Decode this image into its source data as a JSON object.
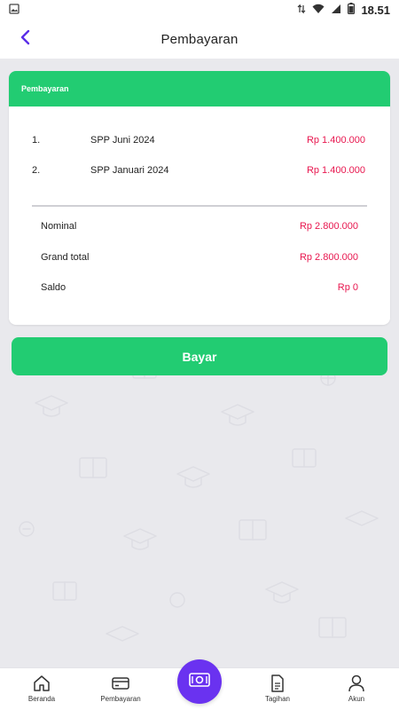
{
  "status_bar": {
    "time": "18.51",
    "icons": [
      "image-icon",
      "data-arrows-icon",
      "wifi-icon",
      "signal-icon",
      "battery-icon"
    ]
  },
  "header": {
    "title": "Pembayaran",
    "back_icon": "chevron-left-icon",
    "back_color": "#5b2ee8"
  },
  "card": {
    "header_title": "Pembayaran",
    "header_color": "#22cc72",
    "items": [
      {
        "number": "1.",
        "name": "SPP Juni 2024",
        "amount": "Rp 1.400.000"
      },
      {
        "number": "2.",
        "name": "SPP Januari 2024",
        "amount": "Rp 1.400.000"
      }
    ],
    "summary": [
      {
        "label": "Nominal",
        "value": "Rp 2.800.000"
      },
      {
        "label": "Grand total",
        "value": "Rp 2.800.000"
      },
      {
        "label": "Saldo",
        "value": "Rp 0"
      }
    ],
    "amount_color": "#e8174f"
  },
  "pay_button": {
    "label": "Bayar",
    "color": "#22cc72"
  },
  "bottom_nav": {
    "items": [
      {
        "label": "Beranda",
        "icon": "home-icon"
      },
      {
        "label": "Pembayaran",
        "icon": "card-icon"
      },
      {
        "label": "Tagihan",
        "icon": "document-icon"
      },
      {
        "label": "Akun",
        "icon": "user-icon"
      }
    ],
    "fab_icon": "money-icon",
    "fab_color": "#6a32f0"
  }
}
